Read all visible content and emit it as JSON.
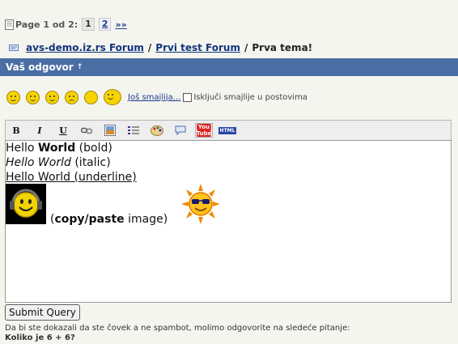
{
  "pager": {
    "label": "Page 1 od 2:",
    "current_page": "1",
    "next_page": "2",
    "next_link": "»»"
  },
  "breadcrumb": {
    "site": "avs-demo.iz.rs Forum",
    "sep1": "/",
    "forum": "Prvi test Forum",
    "sep2": "/",
    "topic": "Prva tema!"
  },
  "reply_header": {
    "title": "Vaš odgovor",
    "arrow": "↑"
  },
  "smilies": {
    "icons": [
      "smile-icon",
      "grin-icon",
      "tongue-icon",
      "sad-icon",
      "blank-icon",
      "thumbs-up-icon"
    ],
    "more_link": "Još smajlija...",
    "disable_label": "Isključi smajlije u postovima"
  },
  "toolbar": {
    "bold": "B",
    "italic": "I",
    "underline": "U",
    "youtube_top": "You",
    "youtube_bottom": "Tube",
    "html": "HTML"
  },
  "editor": {
    "line1_normal": "Hello ",
    "line1_bold": "World",
    "line1_suffix": " (bold)",
    "line2_italic": "Hello World",
    "line2_suffix": " (italic)",
    "line3_underline": "Hello World (underline)",
    "line4_open": "(",
    "line4_bold": "copy/paste",
    "line4_suffix": " image)"
  },
  "form": {
    "submit_label": "Submit Query",
    "antispam_note": "Da bi ste dokazali da ste čovek a ne spambot, molimo odgovorite na sledeće pitanje:",
    "antispam_question": "Koliko je 6 + 6?"
  },
  "colors": {
    "header_bar": "#4a6da4",
    "link": "#12357c",
    "page_bg": "#f5f5ef"
  }
}
